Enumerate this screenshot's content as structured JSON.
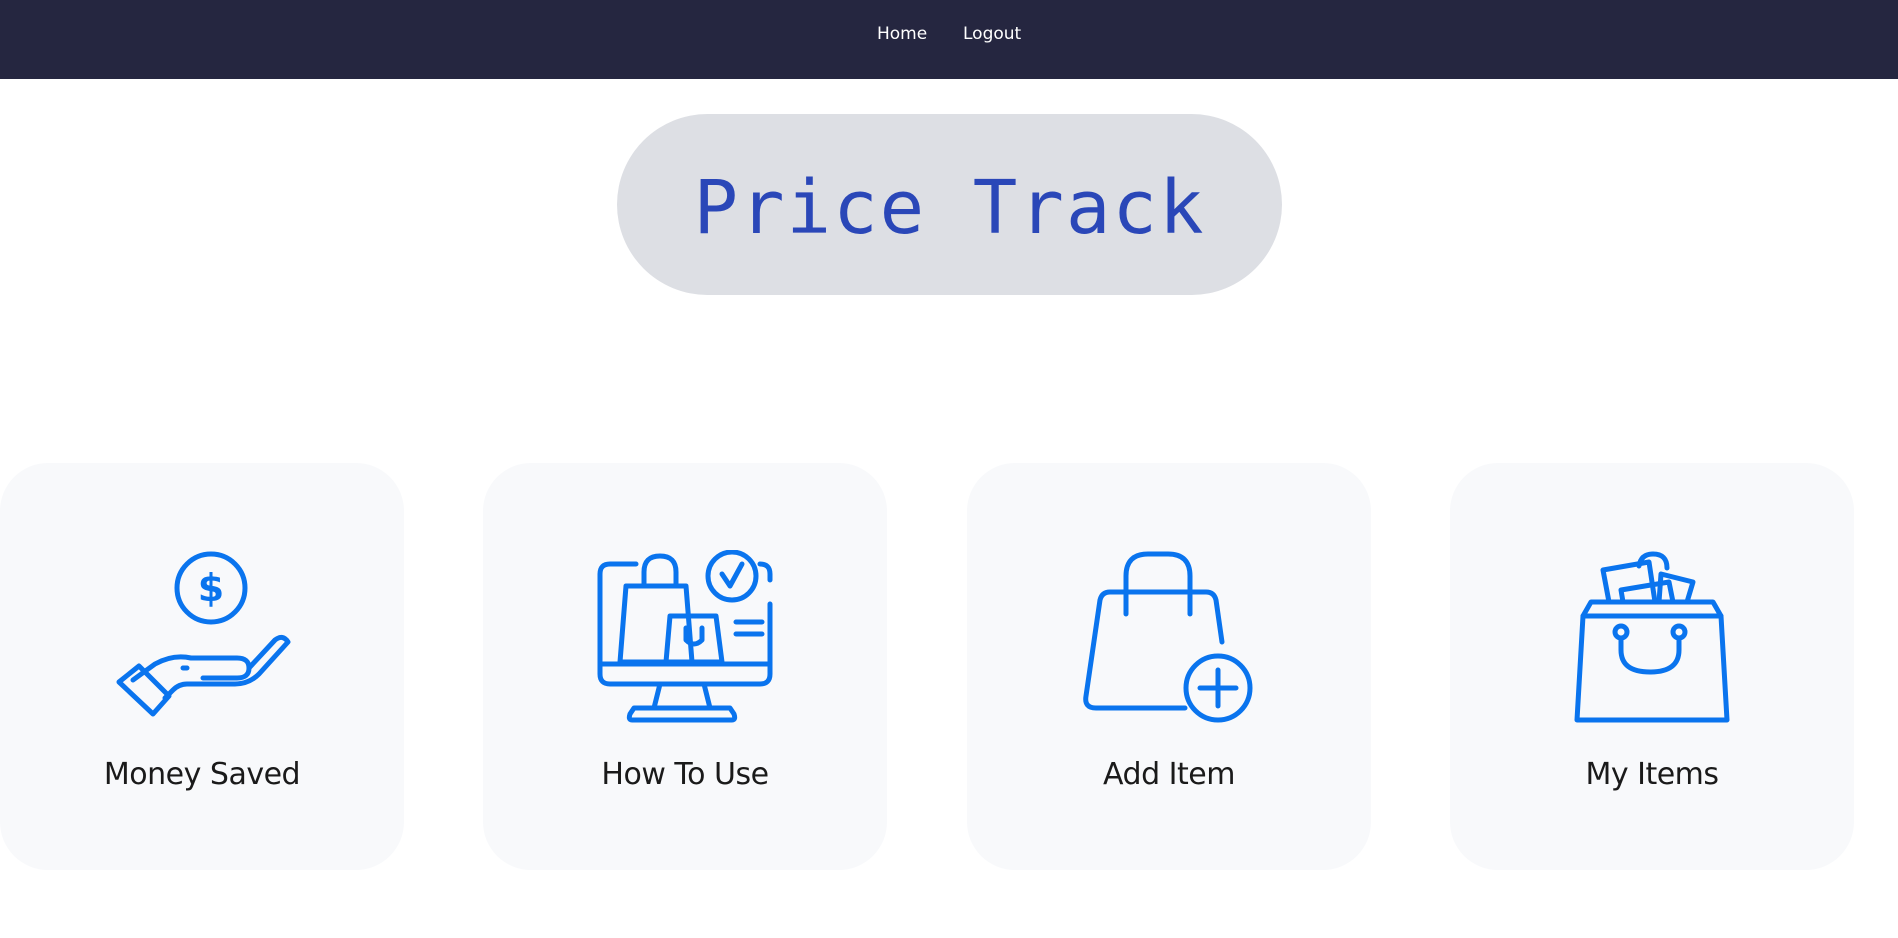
{
  "nav": {
    "home_label": "Home",
    "logout_label": "Logout"
  },
  "title": "Price Track",
  "colors": {
    "navbar": "#252640",
    "title_pill": "#dddfe4",
    "title_text": "#2a47b8",
    "card_bg": "#f8f9fb",
    "icon": "#0a74ee"
  },
  "cards": [
    {
      "label": "Money Saved",
      "icon": "hand-coin-icon"
    },
    {
      "label": "How To Use",
      "icon": "monitor-shopping-icon"
    },
    {
      "label": "Add Item",
      "icon": "bag-add-icon"
    },
    {
      "label": "My Items",
      "icon": "shopping-bag-items-icon"
    }
  ]
}
